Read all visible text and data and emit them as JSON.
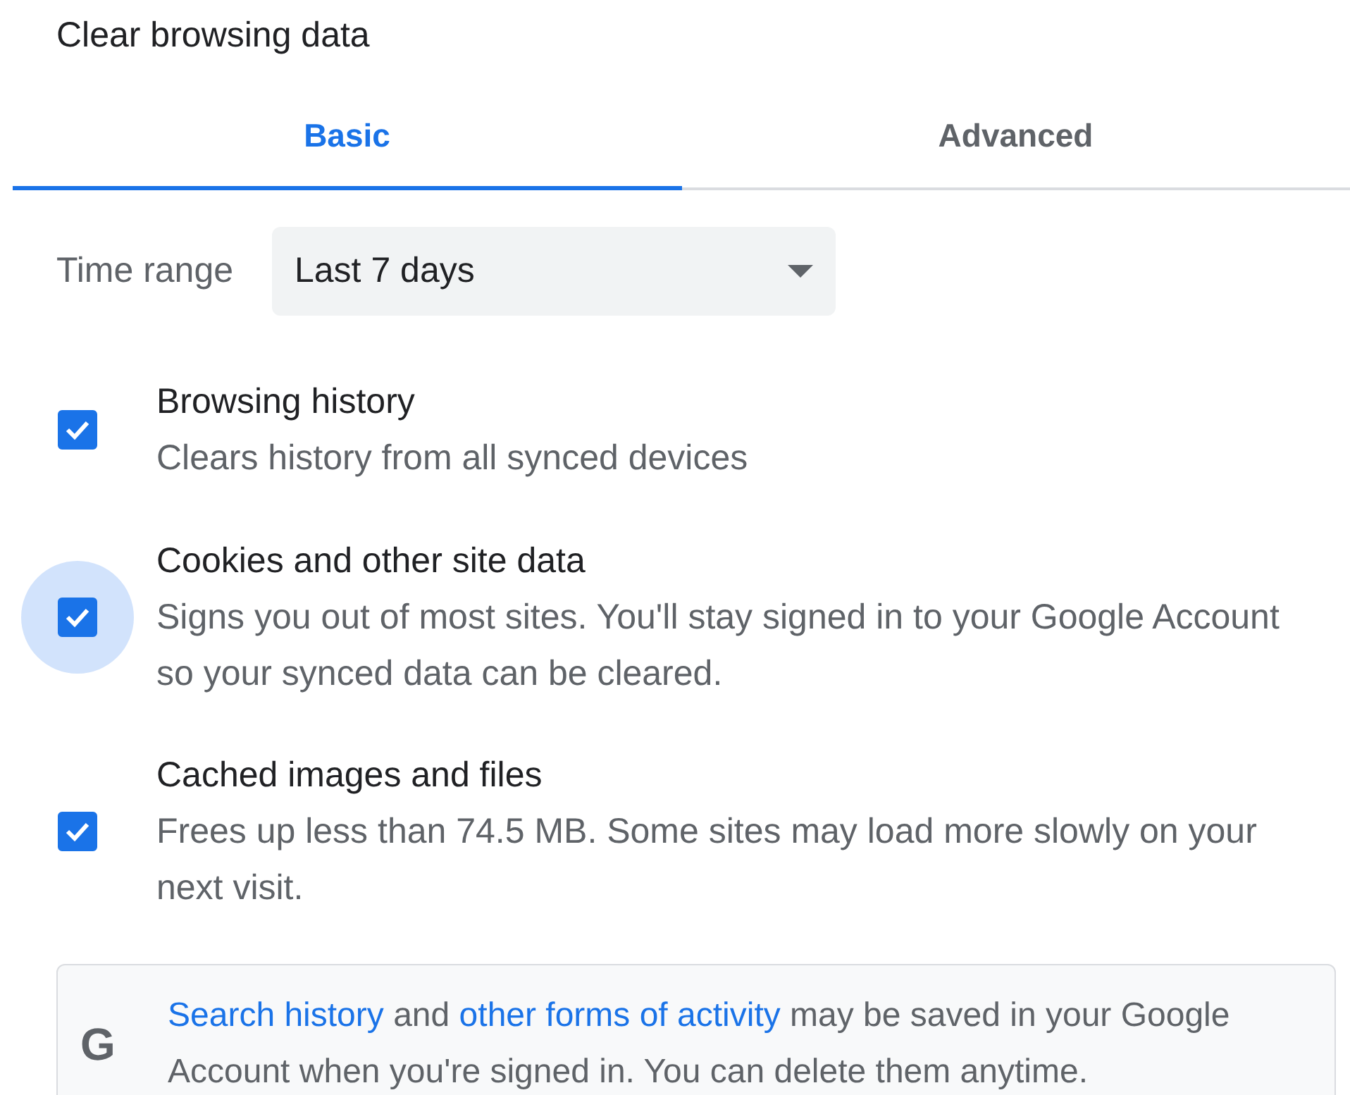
{
  "dialog": {
    "title": "Clear browsing data"
  },
  "tabs": [
    {
      "label": "Basic",
      "selected": true
    },
    {
      "label": "Advanced",
      "selected": false
    }
  ],
  "time_range": {
    "label": "Time range",
    "value": "Last 7 days"
  },
  "options": [
    {
      "title": "Browsing history",
      "description": "Clears history from all synced devices",
      "checked": true,
      "focused": false
    },
    {
      "title": "Cookies and other site data",
      "description": "Signs you out of most sites. You'll stay signed in to your Google Account so your synced data can be cleared.",
      "checked": true,
      "focused": true
    },
    {
      "title": "Cached images and files",
      "description": "Frees up less than 74.5 MB. Some sites may load more slowly on your next visit.",
      "checked": true,
      "focused": false
    }
  ],
  "notice": {
    "logo": "G",
    "parts": [
      {
        "kind": "link",
        "text": "Search history"
      },
      {
        "kind": "text",
        "text": " and "
      },
      {
        "kind": "link",
        "text": "other forms of activity"
      },
      {
        "kind": "text",
        "text": " may be saved in your Google Account when you're signed in. You can delete them anytime."
      }
    ]
  }
}
